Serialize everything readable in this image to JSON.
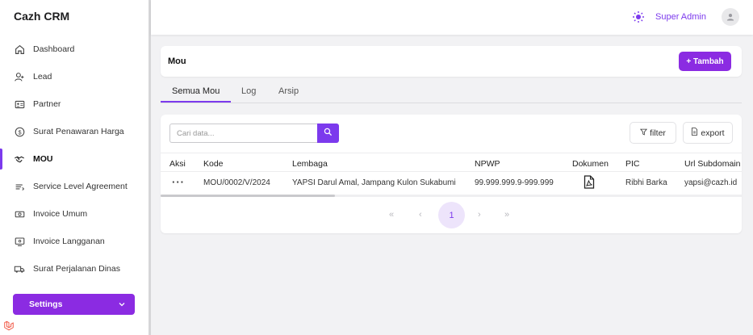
{
  "app": {
    "title": "Cazh CRM"
  },
  "sidebar": {
    "items": [
      {
        "label": "Dashboard",
        "icon": "home-icon"
      },
      {
        "label": "Lead",
        "icon": "user-plus-icon"
      },
      {
        "label": "Partner",
        "icon": "id-card-icon"
      },
      {
        "label": "Surat Penawaran Harga",
        "icon": "dollar-circle-icon"
      },
      {
        "label": "MOU",
        "icon": "handshake-icon",
        "active": true
      },
      {
        "label": "Service Level Agreement",
        "icon": "list-icon"
      },
      {
        "label": "Invoice Umum",
        "icon": "money-icon"
      },
      {
        "label": "Invoice Langganan",
        "icon": "monitor-icon"
      },
      {
        "label": "Surat Perjalanan Dinas",
        "icon": "truck-icon"
      }
    ],
    "settings_label": "Settings"
  },
  "topbar": {
    "user_name": "Super Admin",
    "icons": [
      "sun-icon",
      "user-icon"
    ]
  },
  "page": {
    "title": "Mou",
    "add_label": "+ Tambah"
  },
  "tabs": [
    {
      "label": "Semua Mou",
      "active": true
    },
    {
      "label": "Log"
    },
    {
      "label": "Arsip"
    }
  ],
  "toolbar": {
    "search_placeholder": "Cari data...",
    "filter_label": "filter",
    "export_label": "export"
  },
  "table": {
    "columns": [
      "Aksi",
      "Kode",
      "Lembaga",
      "NPWP",
      "Dokumen",
      "PIC",
      "Url Subdomain"
    ],
    "rows": [
      {
        "aksi": "···",
        "kode": "MOU/0002/V/2024",
        "lembaga": "YAPSI Darul Amal, Jampang Kulon Sukabumi",
        "npwp": "99.999.999.9-999.999",
        "dokumen": "pdf-file-icon",
        "pic": "Ribhi Barka",
        "subdomain": "yapsi@cazh.id"
      }
    ]
  },
  "pagination": {
    "first": "«",
    "prev": "‹",
    "current": "1",
    "next": "›",
    "last": "»"
  },
  "colors": {
    "accent": "#8b2be2",
    "accent_dark": "#7c3aed"
  }
}
